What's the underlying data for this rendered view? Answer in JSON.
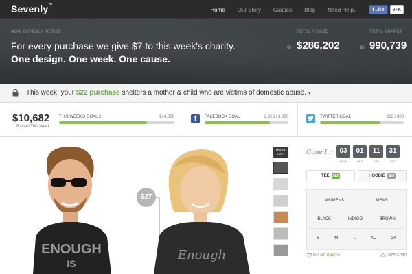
{
  "brand": {
    "logo": "Sevenly",
    "tm": "™"
  },
  "nav": {
    "items": [
      "Home",
      "Our Story",
      "Causes",
      "Blog",
      "Need Help?"
    ],
    "active": "Home",
    "fb_like_label": "Like",
    "fb_like_count": "37K"
  },
  "hero": {
    "kicker": "HOW SEVENLY WORKS",
    "line1": "For every purchase we give $7 to this week's charity.",
    "line2": "One design. One week. One cause.",
    "total_raised_label": "TOTAL RAISED",
    "total_raised_value": "$286,202",
    "total_shares_label": "TOTAL SHARES",
    "total_shares_value": "990,739"
  },
  "charity": {
    "prefix": "This week, your ",
    "highlight": "$22 purchase",
    "suffix": " shelters a mother & child who are victims of domestic abuse.",
    "caret": "▾"
  },
  "goals": {
    "raised_value": "$10,682",
    "raised_label": "Raised This Week",
    "weekly": {
      "label": "THIS WEEK'S GOAL 2",
      "num": "$14,000",
      "progress": 0.76
    },
    "facebook": {
      "label": "FACEBOOK GOAL",
      "num": "2,325 / 3,000",
      "progress": 0.78
    },
    "twitter": {
      "label": "TWITTER GOAL",
      "num": "215 / 300",
      "progress": 0.72
    }
  },
  "product": {
    "price": "$27",
    "model_info": "MODEL INFO",
    "timer_label": "Gone In:",
    "timer": [
      {
        "value": "03",
        "unit": "DAYS"
      },
      {
        "value": "01",
        "unit": "HRS"
      },
      {
        "value": "11",
        "unit": "MIN"
      },
      {
        "value": "31",
        "unit": "SEC"
      }
    ],
    "tee_label": "TEE",
    "tee_price": "$22",
    "hoodie_label": "HOODIE",
    "hoodie_price": "$35",
    "fit": [
      "WOMENS",
      "MENS"
    ],
    "colors": [
      "BLACK",
      "INDIGO",
      "BROWN"
    ],
    "sizes": [
      "S",
      "M",
      "L",
      "XL",
      "2X"
    ],
    "cart_prefix": "In cart:",
    "cart_items": "0 items",
    "size_chart": "Size Chart"
  },
  "colors": {
    "accent_green": "#6cb33f",
    "dark": "#2b2b2b",
    "facebook": "#3b5998",
    "twitter": "#4aa3df"
  }
}
